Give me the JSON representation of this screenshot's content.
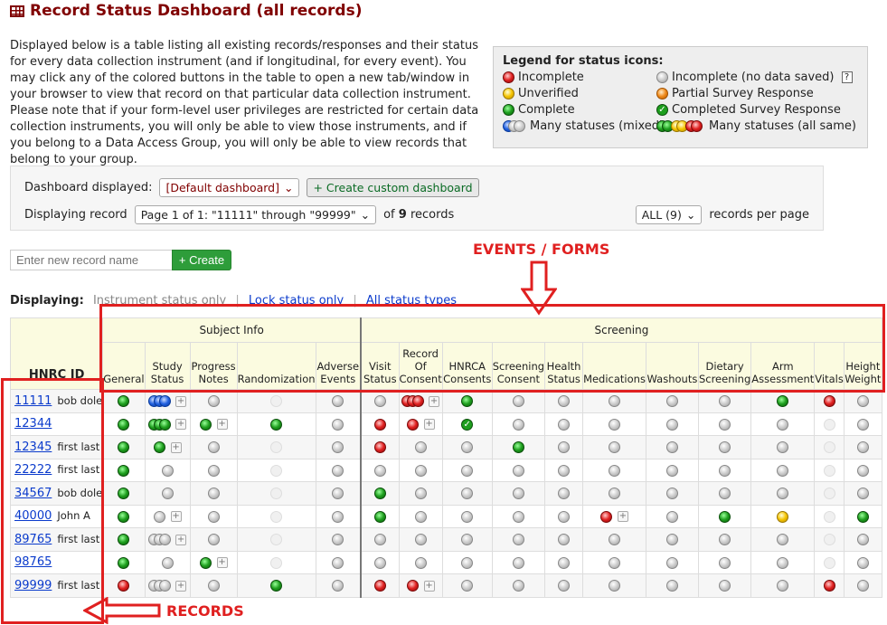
{
  "title": "Record Status Dashboard (all records)",
  "intro": "Displayed below is a table listing all existing records/responses and their status for every data collection instrument (and if longitudinal, for every event). You may click any of the colored buttons in the table to open a new tab/window in your browser to view that record on that particular data collection instrument. Please note that if your form-level user privileges are restricted for certain data collection instruments, you will only be able to view those instruments, and if you belong to a Data Access Group, you will only be able to view records that belong to your group.",
  "legend": {
    "heading": "Legend for status icons:",
    "incomplete": "Incomplete",
    "incomplete_nodata": "Incomplete (no data saved)",
    "help": "?",
    "unverified": "Unverified",
    "partial_survey": "Partial Survey Response",
    "complete": "Complete",
    "completed_survey": "Completed Survey Response",
    "many_mixed": "Many statuses (mixed)",
    "many_same": "Many statuses (all same)"
  },
  "panel": {
    "dashboard_label": "Dashboard displayed:",
    "dashboard_value": "[Default dashboard]",
    "create_custom": "Create custom dashboard",
    "displaying_record_label": "Displaying record",
    "page_value": "Page 1 of 1: \"11111\" through \"99999\"",
    "of_records_prefix": "of",
    "record_count": "9",
    "of_records_suffix": "records",
    "per_page_value": "ALL (9)",
    "per_page_label": "records per page"
  },
  "new_record": {
    "placeholder": "Enter new record name",
    "create_label": "Create"
  },
  "displaying": {
    "label": "Displaying:",
    "instrument_only": "Instrument status only",
    "lock_only": "Lock status only",
    "all_types": "All status types"
  },
  "annotations": {
    "events_forms": "EVENTS / FORMS",
    "records": "RECORDS"
  },
  "table": {
    "id_header": "HNRC ID",
    "sections": [
      "Subject Info",
      "Screening"
    ],
    "columns": [
      "General",
      "Study Status",
      "Progress Notes",
      "Randomization",
      "Adverse Events",
      "Visit Status",
      "Record Of Consent",
      "HNRCA Consents",
      "Screening Consent",
      "Health Status",
      "Medications",
      "Washouts",
      "Dietary Screening",
      "Arm Assessment",
      "Vitals",
      "Height Weight"
    ],
    "records": [
      {
        "id": "11111",
        "name": "bob dole",
        "cells": [
          "green",
          "multi-blue+",
          "gray",
          "faint",
          "gray",
          "gray",
          "multi-red+",
          "green",
          "gray",
          "gray",
          "gray",
          "gray",
          "gray",
          "green",
          "red",
          "gray"
        ]
      },
      {
        "id": "12344",
        "name": "",
        "cells": [
          "green",
          "multi-green+",
          "green+",
          "green",
          "gray",
          "red",
          "red+",
          "check",
          "gray",
          "gray",
          "gray",
          "gray",
          "gray",
          "gray",
          "faint",
          "gray"
        ]
      },
      {
        "id": "12345",
        "name": "first last",
        "cells": [
          "green",
          "green+",
          "gray",
          "faint",
          "gray",
          "red",
          "gray",
          "gray",
          "green",
          "gray",
          "gray",
          "gray",
          "gray",
          "gray",
          "faint",
          "gray"
        ]
      },
      {
        "id": "22222",
        "name": "first last",
        "cells": [
          "green",
          "gray",
          "gray",
          "faint",
          "gray",
          "gray",
          "gray",
          "gray",
          "gray",
          "gray",
          "gray",
          "gray",
          "gray",
          "gray",
          "faint",
          "gray"
        ]
      },
      {
        "id": "34567",
        "name": "bob dole",
        "cells": [
          "green",
          "gray",
          "gray",
          "faint",
          "gray",
          "green",
          "gray",
          "gray",
          "gray",
          "gray",
          "gray",
          "gray",
          "gray",
          "gray",
          "faint",
          "gray"
        ]
      },
      {
        "id": "40000",
        "name": "John A",
        "cells": [
          "green",
          "gray+",
          "gray",
          "faint",
          "gray",
          "green",
          "gray",
          "gray",
          "gray",
          "gray",
          "red+",
          "gray",
          "green",
          "yellow",
          "faint",
          "green"
        ]
      },
      {
        "id": "89765",
        "name": "first last",
        "cells": [
          "green",
          "multi-gray+",
          "gray",
          "faint",
          "gray",
          "gray",
          "gray",
          "gray",
          "gray",
          "gray",
          "gray",
          "gray",
          "gray",
          "gray",
          "faint",
          "gray"
        ]
      },
      {
        "id": "98765",
        "name": "",
        "cells": [
          "green",
          "gray",
          "green+",
          "faint",
          "gray",
          "gray",
          "gray",
          "gray",
          "gray",
          "gray",
          "gray",
          "gray",
          "gray",
          "gray",
          "faint",
          "gray"
        ]
      },
      {
        "id": "99999",
        "name": "first last",
        "cells": [
          "red",
          "multi-gray+",
          "gray",
          "green",
          "gray",
          "red",
          "red+",
          "gray",
          "gray",
          "gray",
          "gray",
          "gray",
          "gray",
          "gray",
          "red",
          "gray"
        ]
      }
    ]
  }
}
